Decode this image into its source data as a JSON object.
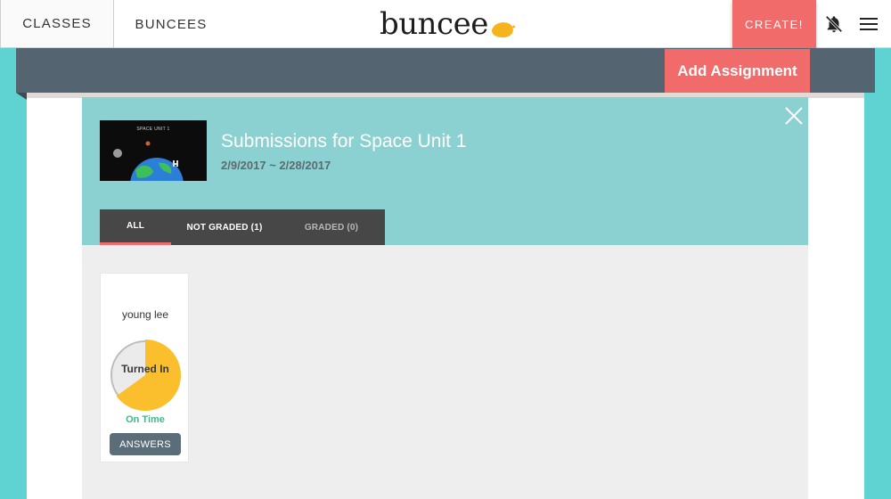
{
  "nav": {
    "classes_label": "CLASSES",
    "buncees_label": "BUNCEES",
    "logo_text": "buncee",
    "create_label": "CREATE!",
    "bell_icon": "bell-muted-icon",
    "menu_icon": "hamburger-menu-icon"
  },
  "class_header": {
    "add_assignment_label": "Add Assignment"
  },
  "modal": {
    "thumbnail_title": "SPACE UNIT 1",
    "title": "Submissions for Space Unit 1",
    "dates": "2/9/2017 ~ 2/28/2017",
    "close_icon": "close-icon",
    "tabs": [
      {
        "label": "ALL",
        "active": true
      },
      {
        "label": "NOT GRADED (1)",
        "active": false
      },
      {
        "label": "GRADED (0)",
        "active": false
      }
    ]
  },
  "submissions": [
    {
      "student": "young lee",
      "status": "Turned In",
      "timing": "On Time",
      "completion_percent": 65,
      "answers_label": "ANSWERS"
    }
  ],
  "colors": {
    "accent": "#f26b6b",
    "teal_background": "#5fd2d2",
    "modal_header": "#8cd1d1",
    "pie_fill": "#fbbf2e",
    "on_time_green": "#3fb886",
    "band": "#546470"
  }
}
